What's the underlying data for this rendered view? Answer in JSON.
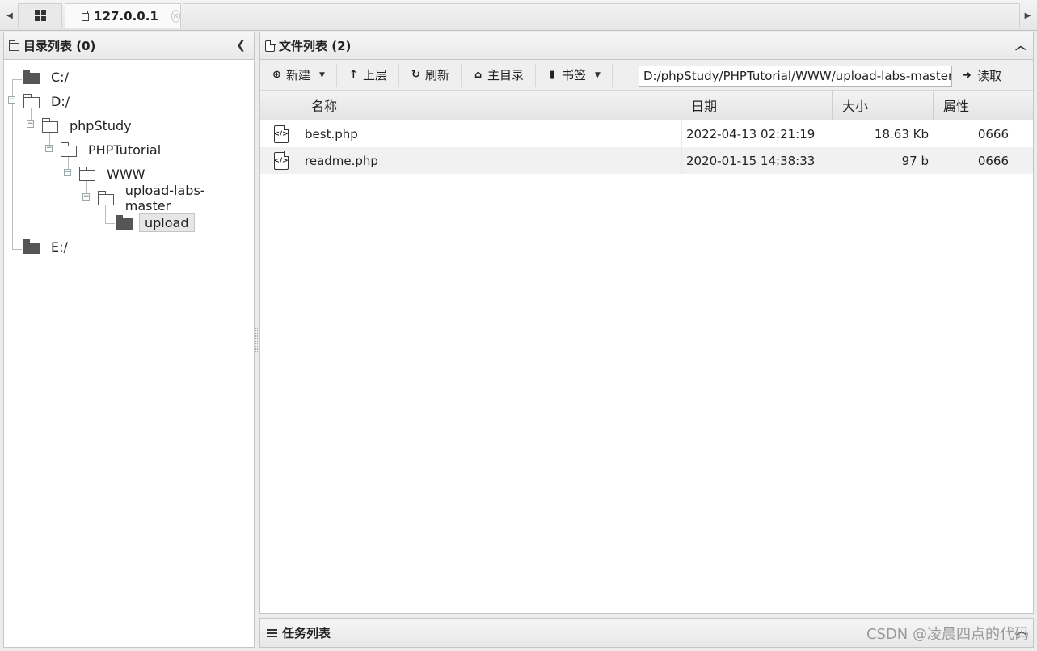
{
  "tabs": {
    "home_icon": "grid-icon",
    "active_tab_label": "127.0.0.1"
  },
  "left_panel": {
    "title": "目录列表 (0)",
    "tree": [
      {
        "label": "C:/",
        "depth": 0
      },
      {
        "label": "D:/",
        "depth": 0
      },
      {
        "label": "phpStudy",
        "depth": 1
      },
      {
        "label": "PHPTutorial",
        "depth": 2
      },
      {
        "label": "WWW",
        "depth": 3
      },
      {
        "label": "upload-labs-master",
        "depth": 4
      },
      {
        "label": "upload",
        "depth": 5,
        "selected": true
      },
      {
        "label": "E:/",
        "depth": 0
      }
    ]
  },
  "right_panel": {
    "title": "文件列表 (2)",
    "toolbar": {
      "new_label": "新建",
      "up_label": "上层",
      "refresh_label": "刷新",
      "home_label": "主目录",
      "bookmark_label": "书签",
      "path_value": "D:/phpStudy/PHPTutorial/WWW/upload-labs-master/upload/",
      "read_label": "读取"
    },
    "columns": [
      "名称",
      "日期",
      "大小",
      "属性"
    ],
    "files": [
      {
        "name": "best.php",
        "date": "2022-04-13 02:21:19",
        "size": "18.63 Kb",
        "attr": "0666"
      },
      {
        "name": "readme.php",
        "date": "2020-01-15 14:38:33",
        "size": "97 b",
        "attr": "0666"
      }
    ]
  },
  "task_panel": {
    "title": "任务列表"
  },
  "watermark": "CSDN @凌晨四点的代码"
}
